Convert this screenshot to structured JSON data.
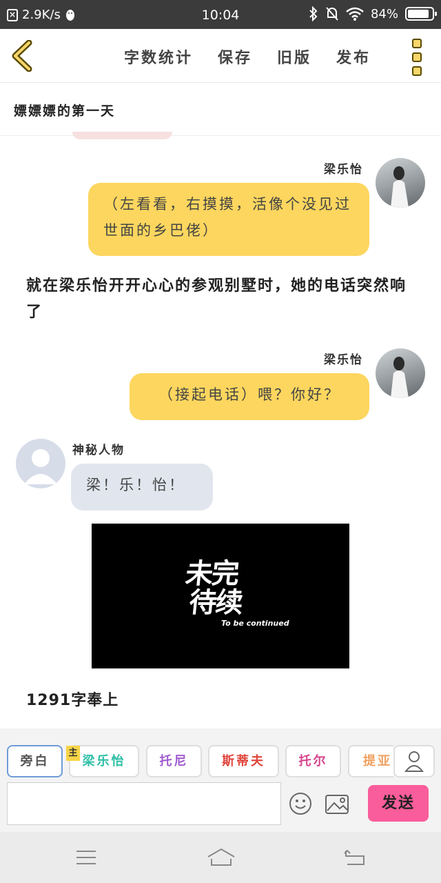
{
  "status": {
    "speed": "2.9K/s",
    "time": "10:04",
    "battery": "84%"
  },
  "toolbar": {
    "word_count_label": "字数统计",
    "save_label": "保存",
    "old_version_label": "旧版",
    "publish_label": "发布"
  },
  "story": {
    "title": "嫖嫖嫖的第一天"
  },
  "messages": [
    {
      "speaker": "梁乐怡",
      "text": "（左看看，右摸摸，活像个没见过世面的乡巴佬）",
      "side": "right"
    },
    {
      "narration": "就在梁乐怡开开心心的参观别墅时，她的电话突然响了"
    },
    {
      "speaker": "梁乐怡",
      "text": "（接起电话）喂？你好？",
      "side": "right"
    },
    {
      "speaker": "神秘人物",
      "text": "梁！乐！怡！",
      "side": "left"
    }
  ],
  "image_card": {
    "line1": "未完",
    "line2": "待续",
    "english": "To be continued"
  },
  "footer_text": "1291字奉上",
  "roles": {
    "owner_tag": "主",
    "items": [
      {
        "label": "旁白",
        "color": "#555555"
      },
      {
        "label": "梁乐怡",
        "color": "#2bbfa5"
      },
      {
        "label": "托尼",
        "color": "#a05bd0"
      },
      {
        "label": "斯蒂夫",
        "color": "#e0453c"
      },
      {
        "label": "托尔",
        "color": "#d6448c"
      },
      {
        "label": "提亚",
        "color": "#f0a060"
      }
    ]
  },
  "composer": {
    "placeholder": "",
    "send_label": "发送"
  },
  "colors": {
    "accent_yellow": "#fcd65e",
    "send_pink": "#f95d9b",
    "gray_bubble": "#e1e6ee"
  }
}
